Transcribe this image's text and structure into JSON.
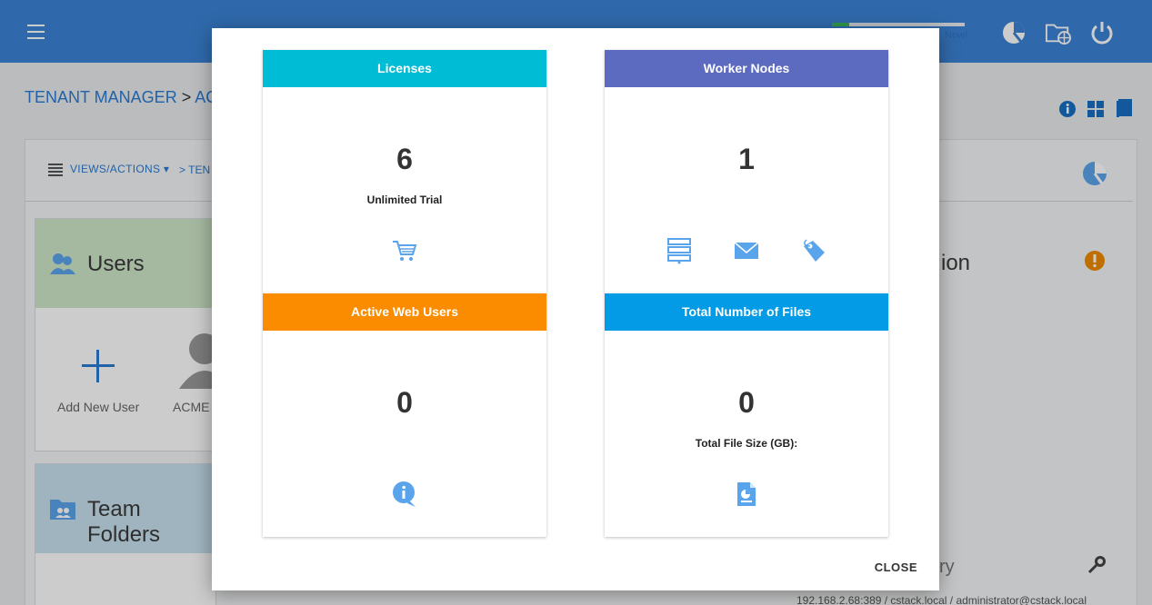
{
  "app": {
    "upgrade_text": "Now!",
    "progress_fraction": 0.13,
    "breadcrumb_root": "TENANT MANAGER",
    "breadcrumb_sep": ">",
    "breadcrumb_current": "ACI",
    "views_label": "VIEWS/ACTIONS",
    "crumb2": "> TEN",
    "users_title": "Users",
    "add_user_label": "Add New User",
    "user_label": "ACME /",
    "team_folders_title": "Team Folders",
    "right_title": "ion",
    "right_title2": "ry",
    "ldap_text": "192.168.2.68:389 / cstack.local / administrator@cstack.local"
  },
  "modal": {
    "tiles": [
      {
        "title": "Licenses",
        "value": "6",
        "subtitle": "Unlimited Trial",
        "color": "#00bcd4",
        "icons": [
          "cart-icon"
        ]
      },
      {
        "title": "Worker Nodes",
        "value": "1",
        "subtitle": "",
        "color": "#5c6bc0",
        "icons": [
          "server-icon",
          "mail-icon",
          "tag-icon"
        ]
      },
      {
        "title": "Active Web Users",
        "value": "0",
        "subtitle": "",
        "color": "#fb8c00",
        "icons": [
          "info-bubble-icon"
        ]
      },
      {
        "title": "Total Number of Files",
        "value": "0",
        "subtitle": "Total File Size (GB):",
        "color": "#039be5",
        "icons": [
          "file-report-icon"
        ]
      }
    ],
    "close_label": "CLOSE"
  },
  "colors": {
    "brand": "#3b84d6",
    "icon_blue": "#5aa4ec"
  }
}
